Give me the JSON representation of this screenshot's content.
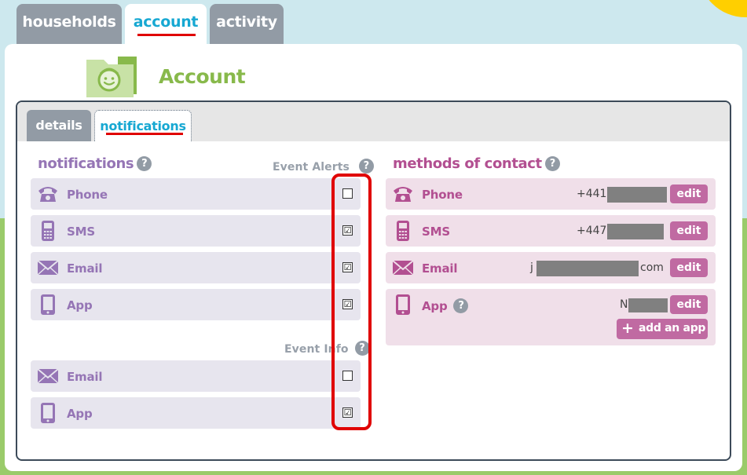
{
  "top_tabs": [
    {
      "label": "households",
      "active": false
    },
    {
      "label": "account",
      "active": true
    },
    {
      "label": "activity",
      "active": false
    }
  ],
  "page": {
    "title": "Account",
    "icon": "folder-face-icon"
  },
  "sub_tabs": [
    {
      "label": "details",
      "active": false
    },
    {
      "label": "notifications",
      "active": true
    }
  ],
  "notifications": {
    "heading": "notifications",
    "event_alerts": {
      "label": "Event Alerts",
      "rows": [
        {
          "label": "Phone",
          "icon": "phone-icon",
          "checked": false
        },
        {
          "label": "SMS",
          "icon": "mobile-phone-icon",
          "checked": true
        },
        {
          "label": "Email",
          "icon": "envelope-icon",
          "checked": true
        },
        {
          "label": "App",
          "icon": "tablet-icon",
          "checked": true
        }
      ]
    },
    "event_info": {
      "label": "Event Info",
      "rows": [
        {
          "label": "Email",
          "icon": "envelope-icon",
          "checked": false
        },
        {
          "label": "App",
          "icon": "tablet-icon",
          "checked": true
        }
      ]
    }
  },
  "methods_of_contact": {
    "heading": "methods of contact",
    "rows": [
      {
        "label": "Phone",
        "icon": "phone-icon",
        "value_prefix": "+4414",
        "value_suffix": "",
        "edit_label": "edit"
      },
      {
        "label": "SMS",
        "icon": "mobile-phone-icon",
        "value_prefix": "+4479",
        "value_suffix": "",
        "edit_label": "edit"
      },
      {
        "label": "Email",
        "icon": "envelope-icon",
        "value_prefix": "j",
        "value_suffix": "com",
        "edit_label": "edit"
      },
      {
        "label": "App",
        "icon": "tablet-icon",
        "value_prefix": "N",
        "value_suffix": "",
        "edit_label": "edit",
        "has_help": true
      }
    ],
    "add_app_label": "add an app"
  },
  "colors": {
    "accent_blue": "#17a8d2",
    "purple": "#9575b5",
    "pink": "#b24f91",
    "edit_button": "#c06aa2",
    "title_green": "#88b94b",
    "highlight_red": "#e00000"
  },
  "checkmark": "☑",
  "help_glyph": "?"
}
